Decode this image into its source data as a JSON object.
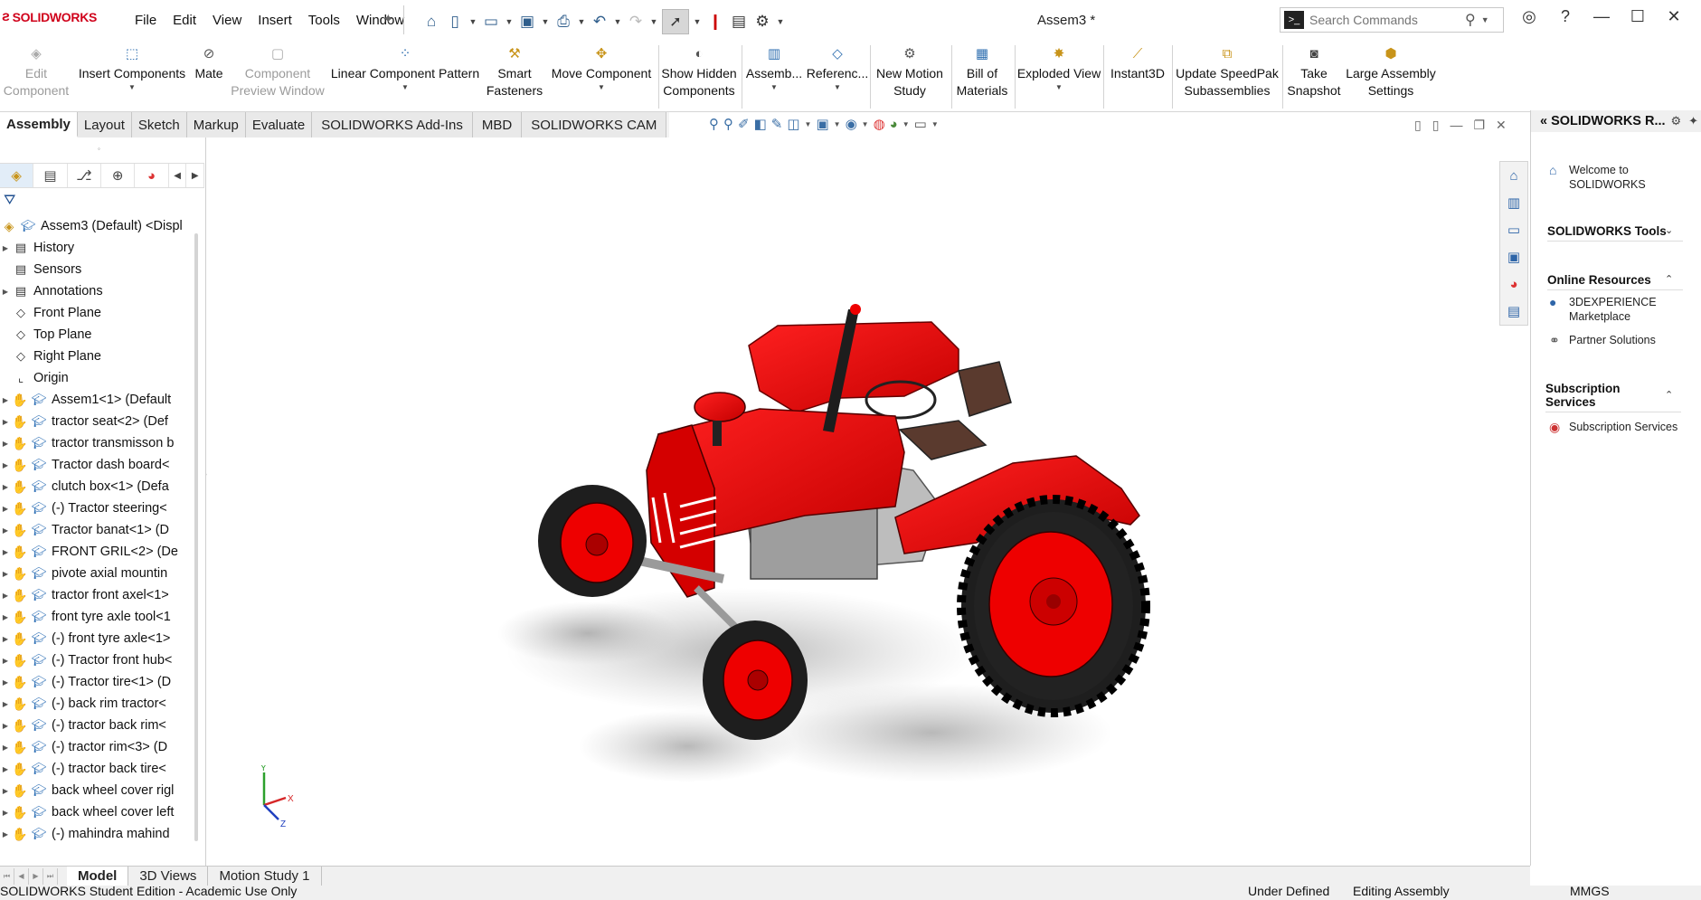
{
  "app": {
    "logo_text": "SOLIDWORKS",
    "doc_title": "Assem3 *"
  },
  "menus": [
    "File",
    "Edit",
    "View",
    "Insert",
    "Tools",
    "Window"
  ],
  "search": {
    "placeholder": "Search Commands"
  },
  "commands": [
    {
      "label": "Edit\nComponent",
      "icon": "edit-component-icon",
      "enabled": false
    },
    {
      "label": "Insert Components",
      "icon": "insert-components-icon",
      "enabled": true
    },
    {
      "label": "Mate",
      "icon": "mate-icon",
      "enabled": true
    },
    {
      "label": "Component\nPreview Window",
      "icon": "preview-window-icon",
      "enabled": false
    },
    {
      "label": "Linear Component Pattern",
      "icon": "pattern-icon",
      "enabled": true
    },
    {
      "label": "Smart\nFasteners",
      "icon": "fasteners-icon",
      "enabled": true
    },
    {
      "label": "Move Component",
      "icon": "move-component-icon",
      "enabled": true
    },
    {
      "label": "Show Hidden\nComponents",
      "icon": "show-hidden-icon",
      "enabled": true
    },
    {
      "label": "Assemb...",
      "icon": "assembly-features-icon",
      "enabled": true
    },
    {
      "label": "Referenc...",
      "icon": "reference-geometry-icon",
      "enabled": true
    },
    {
      "label": "New Motion\nStudy",
      "icon": "motion-study-icon",
      "enabled": true
    },
    {
      "label": "Bill of\nMaterials",
      "icon": "bom-icon",
      "enabled": true
    },
    {
      "label": "Exploded View",
      "icon": "exploded-view-icon",
      "enabled": true
    },
    {
      "label": "Instant3D",
      "icon": "instant3d-icon",
      "enabled": true
    },
    {
      "label": "Update SpeedPak\nSubassemblies",
      "icon": "speedpak-icon",
      "enabled": true
    },
    {
      "label": "Take\nSnapshot",
      "icon": "snapshot-icon",
      "enabled": true
    },
    {
      "label": "Large Assembly\nSettings",
      "icon": "large-assembly-icon",
      "enabled": true
    }
  ],
  "tabs": [
    "Assembly",
    "Layout",
    "Sketch",
    "Markup",
    "Evaluate",
    "SOLIDWORKS Add-Ins",
    "MBD",
    "SOLIDWORKS CAM"
  ],
  "tree": {
    "root": "Assem3 (Default) <Displ",
    "items": [
      {
        "label": "History",
        "expandable": true,
        "type": "folder"
      },
      {
        "label": "Sensors",
        "expandable": false,
        "type": "folder"
      },
      {
        "label": "Annotations",
        "expandable": true,
        "type": "folder"
      },
      {
        "label": "Front Plane",
        "expandable": false,
        "type": "plane"
      },
      {
        "label": "Top Plane",
        "expandable": false,
        "type": "plane"
      },
      {
        "label": "Right Plane",
        "expandable": false,
        "type": "plane"
      },
      {
        "label": "Origin",
        "expandable": false,
        "type": "origin"
      },
      {
        "label": "Assem1<1> (Default",
        "expandable": true,
        "type": "component"
      },
      {
        "label": "tractor seat<2> (Def",
        "expandable": true,
        "type": "component"
      },
      {
        "label": "tractor transmisson b",
        "expandable": true,
        "type": "component"
      },
      {
        "label": "Tractor dash board<",
        "expandable": true,
        "type": "component"
      },
      {
        "label": "clutch box<1> (Defa",
        "expandable": true,
        "type": "component"
      },
      {
        "label": "(-) Tractor steering<",
        "expandable": true,
        "type": "component"
      },
      {
        "label": "Tractor banat<1> (D",
        "expandable": true,
        "type": "component"
      },
      {
        "label": "FRONT GRIL<2> (De",
        "expandable": true,
        "type": "component"
      },
      {
        "label": "pivote axial mountin",
        "expandable": true,
        "type": "component"
      },
      {
        "label": "tractor front axel<1>",
        "expandable": true,
        "type": "component"
      },
      {
        "label": "front tyre axle tool<1",
        "expandable": true,
        "type": "component"
      },
      {
        "label": "(-) front tyre axle<1>",
        "expandable": true,
        "type": "component"
      },
      {
        "label": "(-) Tractor front hub<",
        "expandable": true,
        "type": "component"
      },
      {
        "label": "(-) Tractor tire<1> (D",
        "expandable": true,
        "type": "component"
      },
      {
        "label": "(-) back rim tractor<",
        "expandable": true,
        "type": "component"
      },
      {
        "label": "(-) tractor back rim<",
        "expandable": true,
        "type": "component"
      },
      {
        "label": "(-) tractor rim<3> (D",
        "expandable": true,
        "type": "component"
      },
      {
        "label": "(-) tractor back tire<",
        "expandable": true,
        "type": "component"
      },
      {
        "label": "back wheel cover rigl",
        "expandable": true,
        "type": "component"
      },
      {
        "label": "back wheel cover left",
        "expandable": true,
        "type": "component"
      },
      {
        "label": "(-) mahindra mahind",
        "expandable": true,
        "type": "component"
      }
    ]
  },
  "taskpane": {
    "title": "SOLIDWORKS R...",
    "welcome": "Welcome to\nSOLIDWORKS",
    "tools_header": "SOLIDWORKS Tools",
    "online_header": "Online Resources",
    "online_items": [
      "3DEXPERIENCE\nMarketplace",
      "Partner Solutions"
    ],
    "sub_header": "Subscription\nServices",
    "sub_items": [
      "Subscription Services"
    ]
  },
  "triad": {
    "x": "X",
    "y": "Y",
    "z": "Z"
  },
  "bottom_tabs": [
    "Model",
    "3D Views",
    "Motion Study 1"
  ],
  "status": {
    "left": "SOLIDWORKS Student Edition - Academic Use Only",
    "defined": "Under Defined",
    "mode": "Editing Assembly",
    "units": "MMGS"
  },
  "colors": {
    "accent": "#d0021b",
    "body_red": "#e00000",
    "tire": "#1e1e1e"
  }
}
